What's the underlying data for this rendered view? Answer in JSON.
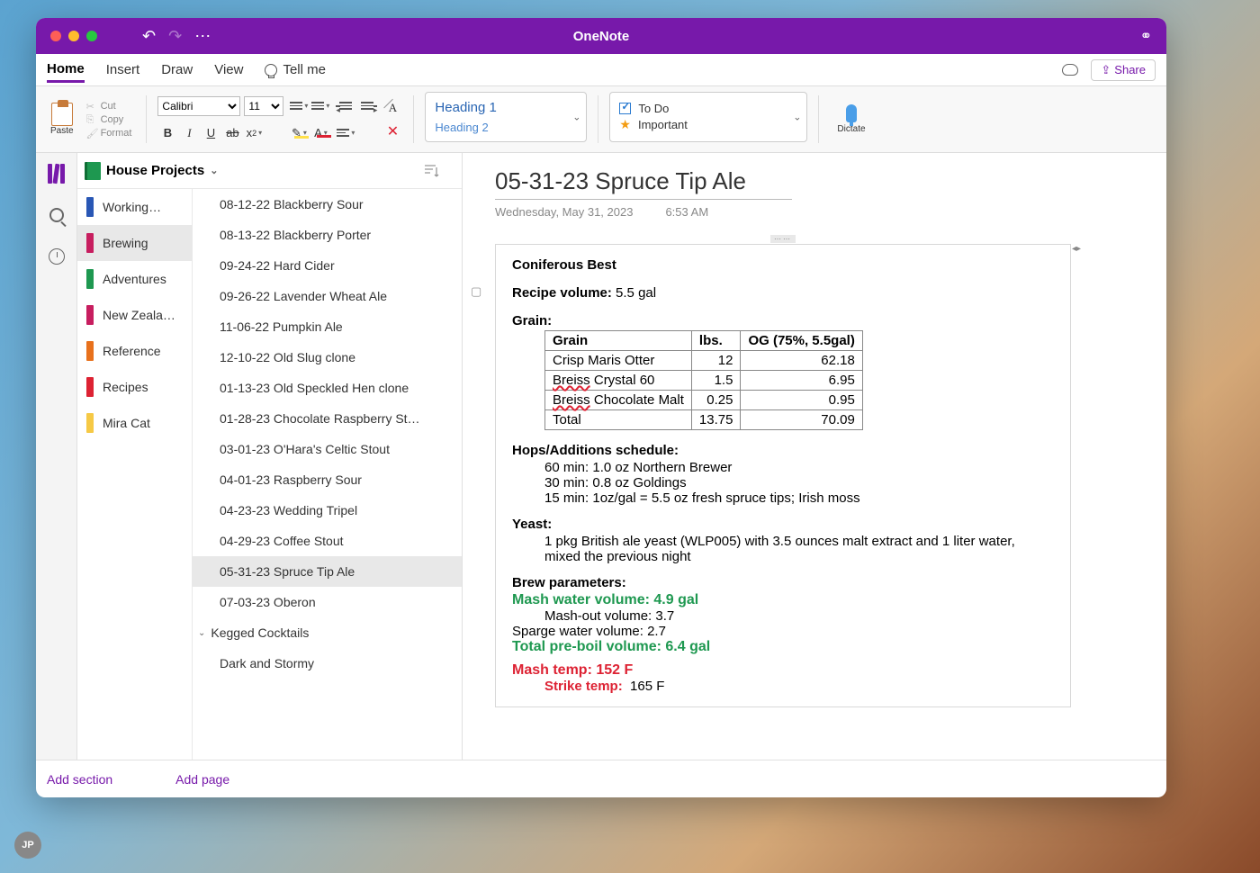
{
  "window": {
    "title": "OneNote"
  },
  "avatar": "JP",
  "tabs": {
    "items": [
      "Home",
      "Insert",
      "Draw",
      "View"
    ],
    "active": 0,
    "tellme": "Tell me",
    "share": "Share"
  },
  "ribbon": {
    "paste": "Paste",
    "cut": "Cut",
    "copy": "Copy",
    "format": "Format",
    "font": "Calibri",
    "size": "11",
    "heading1": "Heading 1",
    "heading2": "Heading 2",
    "todo": "To Do",
    "important": "Important",
    "dictate": "Dictate"
  },
  "notebook": {
    "name": "House Projects"
  },
  "sections": [
    {
      "label": "Working…",
      "color": "#2957b5"
    },
    {
      "label": "Brewing",
      "color": "#c71e5f",
      "active": true
    },
    {
      "label": "Adventures",
      "color": "#1e9850"
    },
    {
      "label": "New Zeala…",
      "color": "#c71e5f"
    },
    {
      "label": "Reference",
      "color": "#e8711c"
    },
    {
      "label": "Recipes",
      "color": "#d23"
    },
    {
      "label": "Mira Cat",
      "color": "#f6c945"
    }
  ],
  "pages": [
    "08-12-22 Blackberry Sour",
    "08-13-22 Blackberry Porter",
    "09-24-22 Hard Cider",
    "09-26-22 Lavender Wheat Ale",
    "11-06-22 Pumpkin Ale",
    "12-10-22 Old Slug clone",
    "01-13-23 Old Speckled Hen clone",
    "01-28-23 Chocolate Raspberry St…",
    "03-01-23 O'Hara's Celtic Stout",
    "04-01-23 Raspberry Sour",
    "04-23-23 Wedding Tripel",
    "04-29-23 Coffee Stout",
    "05-31-23 Spruce Tip Ale",
    "07-03-23 Oberon"
  ],
  "active_page": 12,
  "subsection": "Kegged Cocktails",
  "subpages": [
    "Dark and Stormy"
  ],
  "add_section": "Add section",
  "add_page": "Add page",
  "page": {
    "title": "05-31-23 Spruce Tip Ale",
    "date": "Wednesday, May 31, 2023",
    "time": "6:53 AM",
    "container_title": "Coniferous Best",
    "recipe_volume_label": "Recipe volume:",
    "recipe_volume": "5.5 gal",
    "grain_label": "Grain:",
    "grain_table": {
      "headers": [
        "Grain",
        "lbs.",
        "OG (75%, 5.5gal)"
      ],
      "rows": [
        [
          "Crisp Maris Otter",
          "12",
          "62.18"
        ],
        [
          "Breiss Crystal 60",
          "1.5",
          "6.95"
        ],
        [
          "Breiss Chocolate Malt",
          "0.25",
          "0.95"
        ],
        [
          "Total",
          "13.75",
          "70.09"
        ]
      ]
    },
    "hops_label": "Hops/Additions schedule:",
    "hops": [
      "60 min: 1.0 oz Northern Brewer",
      "30 min: 0.8 oz Goldings",
      "15 min: 1oz/gal = 5.5 oz fresh spruce tips; Irish moss"
    ],
    "yeast_label": "Yeast:",
    "yeast": "1 pkg British ale yeast (WLP005) with 3.5 ounces malt extract and 1 liter water, mixed the previous night",
    "brew_label": "Brew parameters:",
    "mash_water": "Mash water volume: 4.9 gal",
    "mash_out": "Mash-out volume: 3.7",
    "sparge": "Sparge water volume: 2.7",
    "pre_boil": "Total pre-boil volume: 6.4 gal",
    "mash_temp": "Mash temp: 152 F",
    "strike_temp_label": "Strike temp:",
    "strike_temp_val": "165 F"
  }
}
